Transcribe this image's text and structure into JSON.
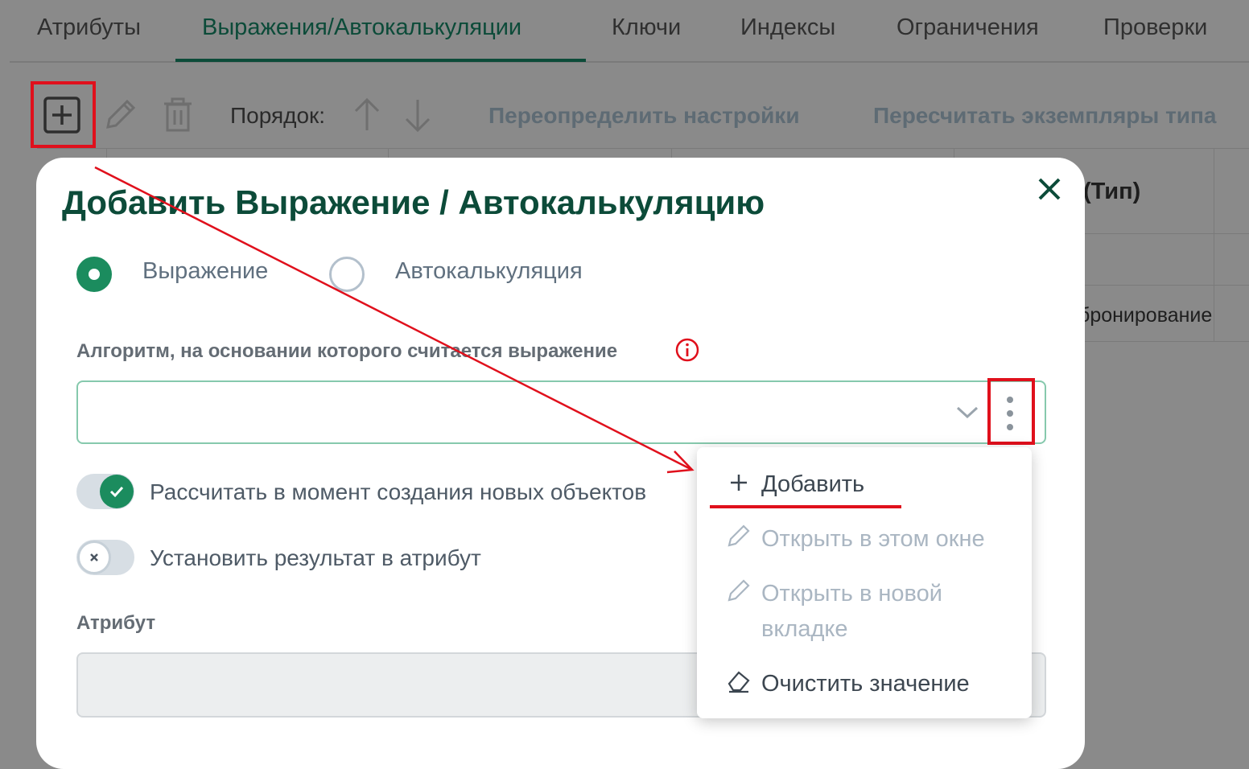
{
  "tabs": [
    {
      "label": "Атрибуты"
    },
    {
      "label": "Выражения/Автокалькуляции",
      "active": true
    },
    {
      "label": "Ключи"
    },
    {
      "label": "Индексы"
    },
    {
      "label": "Ограничения"
    },
    {
      "label": "Проверки"
    }
  ],
  "toolbar": {
    "order_label": "Порядок:",
    "override_settings": "Переопределить настройки",
    "recalculate_instances": "Пересчитать экземпляры типа"
  },
  "background_table": {
    "header_partial": "(Тип)",
    "cell_partial": "бронирование"
  },
  "modal": {
    "title": "Добавить Выражение / Автокалькуляцию",
    "radio_options": [
      {
        "label": "Выражение",
        "selected": true
      },
      {
        "label": "Автокалькуляция",
        "selected": false
      }
    ],
    "algorithm_label": "Алгоритм, на основании которого считается выражение",
    "algorithm_value": "",
    "toggles": [
      {
        "label": "Рассчитать в момент создания новых объектов",
        "on": true
      },
      {
        "label": "Установить результат в атрибут",
        "on": false
      }
    ],
    "attribute_label": "Атрибут",
    "attribute_value": ""
  },
  "menu": {
    "items": [
      {
        "label": "Добавить",
        "icon": "plus-icon",
        "enabled": true
      },
      {
        "label": "Открыть в этом окне",
        "icon": "pencil-icon",
        "enabled": false
      },
      {
        "label": "Открыть в новой вкладке",
        "icon": "pencil-icon",
        "enabled": false
      },
      {
        "label": "Очистить значение",
        "icon": "eraser-icon",
        "enabled": true
      }
    ]
  },
  "colors": {
    "accent": "#1b8c5e",
    "title": "#0c4b39",
    "annotation_red": "#e0101c",
    "disabled_text": "#aab6c2"
  }
}
